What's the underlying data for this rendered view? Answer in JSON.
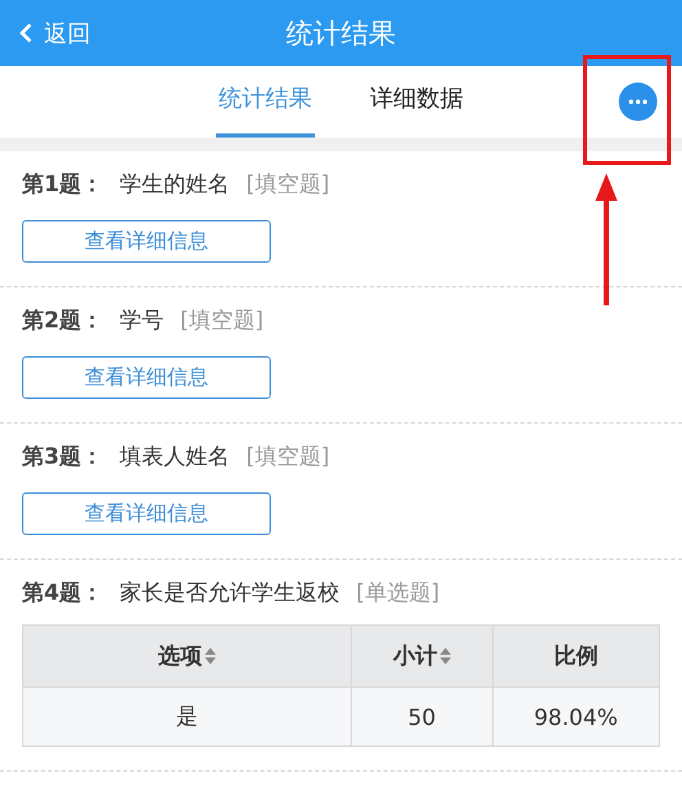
{
  "header": {
    "back": "返回",
    "title": "统计结果"
  },
  "tabs": [
    {
      "label": "统计结果",
      "selected": true
    },
    {
      "label": "详细数据",
      "selected": false
    }
  ],
  "questions": [
    {
      "number": "第1题：",
      "title": "学生的姓名",
      "type": "[填空题]",
      "button": "查看详细信息"
    },
    {
      "number": "第2题：",
      "title": "学号",
      "type": "[填空题]",
      "button": "查看详细信息"
    },
    {
      "number": "第3题：",
      "title": "填表人姓名",
      "type": "[填空题]",
      "button": "查看详细信息"
    },
    {
      "number": "第4题：",
      "title": "家长是否允许学生返校",
      "type": "[单选题]",
      "table": {
        "columns": [
          {
            "label": "选项",
            "sortable": true
          },
          {
            "label": "小计",
            "sortable": true
          },
          {
            "label": "比例",
            "sortable": false
          }
        ],
        "rows": [
          [
            "是",
            "50",
            "98.04%"
          ]
        ]
      }
    }
  ]
}
